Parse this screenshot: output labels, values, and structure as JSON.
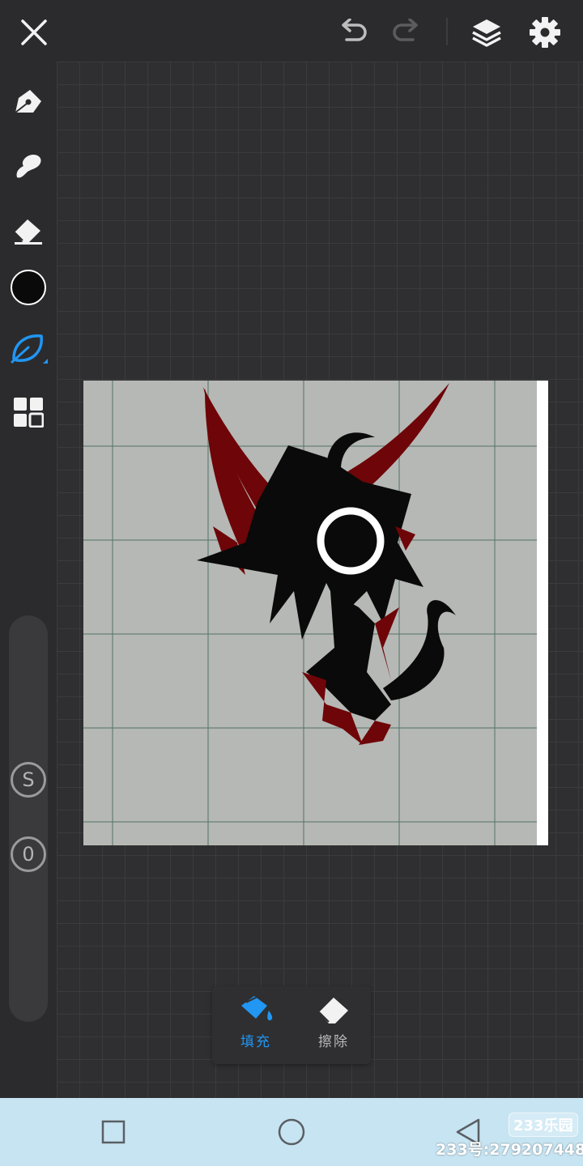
{
  "topbar": {
    "icons": [
      "close-icon",
      "undo-icon",
      "redo-icon",
      "layers-icon",
      "settings-icon"
    ]
  },
  "sidebar": {
    "tools": [
      "pen-icon",
      "smudge-icon",
      "eraser-icon",
      "color-swatch",
      "leaf-brush-icon",
      "grid-icon"
    ],
    "current_color": "#0a0a0a",
    "accent": "#2196f3",
    "size_knob_label": "S",
    "opacity_knob_label": "0"
  },
  "fill_panel": {
    "fill_label": "填充",
    "erase_label": "擦除",
    "active_color": "#2196f3",
    "inactive_color": "#b9b9bc"
  },
  "navbar": {
    "icons": [
      "recent-apps-icon",
      "home-icon",
      "back-icon"
    ]
  },
  "watermark": {
    "logo_text": "233乐园",
    "id_text": "233号:279207448"
  }
}
